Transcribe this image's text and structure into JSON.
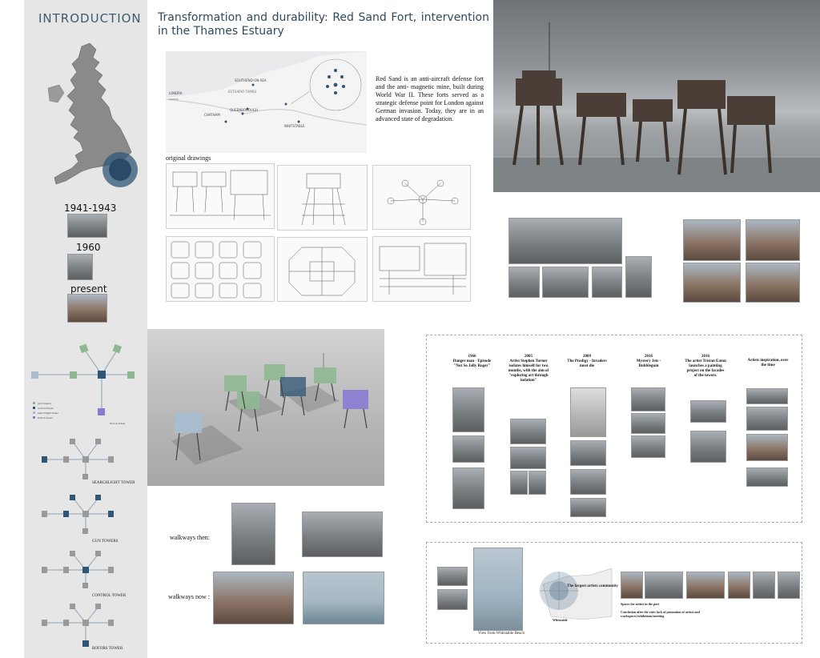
{
  "sidebar": {
    "title": "INTRODUCTION",
    "timeline": [
      {
        "label": "1941-1943"
      },
      {
        "label": "1960"
      },
      {
        "label": "present"
      }
    ]
  },
  "header": {
    "title": "Transformation and durability: Red Sand Fort, intervention in the Thames Estuary"
  },
  "map": {
    "labels": {
      "london": "LONDRA",
      "southend": "SOUTHEND-ON-SEA",
      "sheerness": "QUEENBOROUGH",
      "chatham": "CHATHAM",
      "whitstable": "WHITSTABLE",
      "estuary": "ESTUARIO TAMIGI"
    }
  },
  "intro": {
    "text": "Red Sand is an anti-aircraft defense fort and the anti- magnetic mine, built during World War II. These forts served as a strategic defense point for London against German invasion. Today, they are in an advanced state of degradation."
  },
  "drawings": {
    "label": "original drawings"
  },
  "tower_types": {
    "legend": [
      "gun towers",
      "control tower",
      "searchlight tower",
      "bofors tower"
    ],
    "legend_note": "Tunnel tubes",
    "captions": [
      "SEARCHLIGHT TOWER",
      "GUN TOWERS",
      "CONTROL TOWER",
      "BOFORS TOWER"
    ]
  },
  "walkways": {
    "then": "walkways then:",
    "now": "walkways now :"
  },
  "timeline": {
    "events": [
      {
        "year": "1966",
        "text": "Danger man - Episode \"Not So Jolly Roger\""
      },
      {
        "year": "2005",
        "text": "Artist Stephen Turner isolates himself for two months, with the aim of \"exploring art through isolation\""
      },
      {
        "year": "2009",
        "text": "The Prodigy - Invaders must die"
      },
      {
        "year": "2016",
        "text": "Mystery Jets - Bubblegum"
      },
      {
        "year": "2016",
        "text": "The artist Tristan Eaton launches a painting project on the facades of the towers."
      },
      {
        "year": "",
        "text": "Artists inspiration, over the time"
      }
    ]
  },
  "beach": {
    "caption": "View from Whitstable Beach",
    "community": "The largest artists community",
    "town": "Whitstable",
    "note1": "Spaces for artists in the port",
    "note2": "Conclusion after the visit: lack of promotion of artists and workspaces/exhibitions/meeting"
  },
  "colors": {
    "accent": "#3f5a6e",
    "tower_blue": "#2f5577",
    "tower_green": "#8fb891",
    "tower_lightblue": "#a9bed1",
    "tower_purple": "#8a7bd1",
    "sidebar_bg": "#e6e6e6"
  }
}
